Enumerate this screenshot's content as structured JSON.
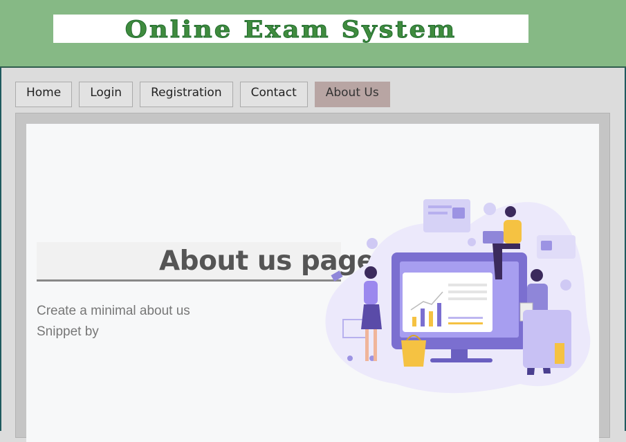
{
  "header": {
    "title": "Online Exam System"
  },
  "nav": {
    "items": [
      {
        "label": "Home",
        "name": "nav-home"
      },
      {
        "label": "Login",
        "name": "nav-login"
      },
      {
        "label": "Registration",
        "name": "nav-registration"
      },
      {
        "label": "Contact",
        "name": "nav-contact"
      },
      {
        "label": "About Us",
        "name": "nav-about-us"
      }
    ],
    "active": "About Us"
  },
  "main": {
    "heading": "About us page",
    "line1": "Create a minimal about us",
    "line2": "Snippet by"
  },
  "colors": {
    "header_bg": "#86b985",
    "title_green": "#3f8b3e",
    "active_tab": "#b8a5a3",
    "illustration_purple": "#7b6fd0",
    "illustration_yellow": "#f5c242"
  },
  "illustration": {
    "icon": "about-us-illustration"
  }
}
